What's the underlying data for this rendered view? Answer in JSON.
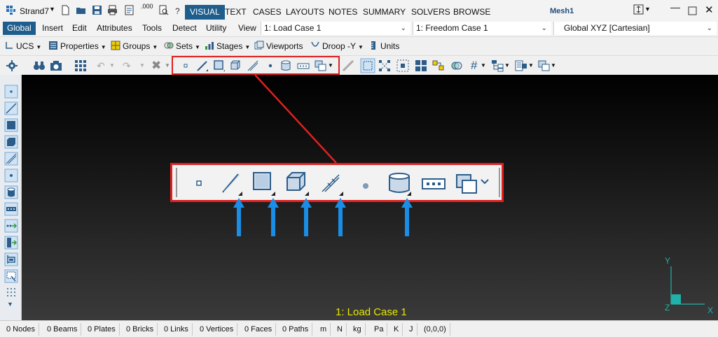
{
  "app": {
    "name": "Strand7",
    "mesh_title": "Mesh1",
    "ribbon_tabs": [
      "VISUAL",
      "TEXT",
      "CASES",
      "LAYOUTS",
      "NOTES",
      "SUMMARY",
      "SOLVERS",
      "BROWSE"
    ],
    "ribbon_active": "VISUAL",
    "quick_access_value": ".000"
  },
  "menu": {
    "items": [
      "Global",
      "Insert",
      "Edit",
      "Attributes",
      "Tools",
      "Detect",
      "Utility",
      "View"
    ],
    "active": "Global",
    "load_case": "1: Load Case 1",
    "freedom_case": "1: Freedom Case 1",
    "coord_system": "Global XYZ [Cartesian]"
  },
  "toolbar1": {
    "ucs": "UCS",
    "properties": "Properties",
    "groups": "Groups",
    "sets": "Sets",
    "stages": "Stages",
    "viewports": "Viewports",
    "droop": "Droop -Y",
    "units": "Units"
  },
  "viewport": {
    "load_case_label": "1: Load Case 1",
    "axes": {
      "y": "Y",
      "z": "Z",
      "x": "X"
    }
  },
  "status": [
    "0 Nodes",
    "0 Beams",
    "0 Plates",
    "0 Bricks",
    "0 Links",
    "0 Vertices",
    "0 Faces",
    "0 Paths",
    "m",
    "N",
    "kg",
    "Pa",
    "K",
    "J",
    "(0,0,0)"
  ],
  "callout_tools": [
    "node-tool",
    "beam-tool",
    "plate-tool",
    "brick-tool",
    "link-tool",
    "vertex-tool",
    "face-tool",
    "path-tool",
    "more-elements-dropdown"
  ],
  "colors": {
    "accent": "#1f5e8c",
    "callout_red": "#e02020",
    "arrow_blue": "#1a8ee6",
    "load_case_yellow": "#e8e800",
    "axis_cyan": "#20b2aa"
  }
}
